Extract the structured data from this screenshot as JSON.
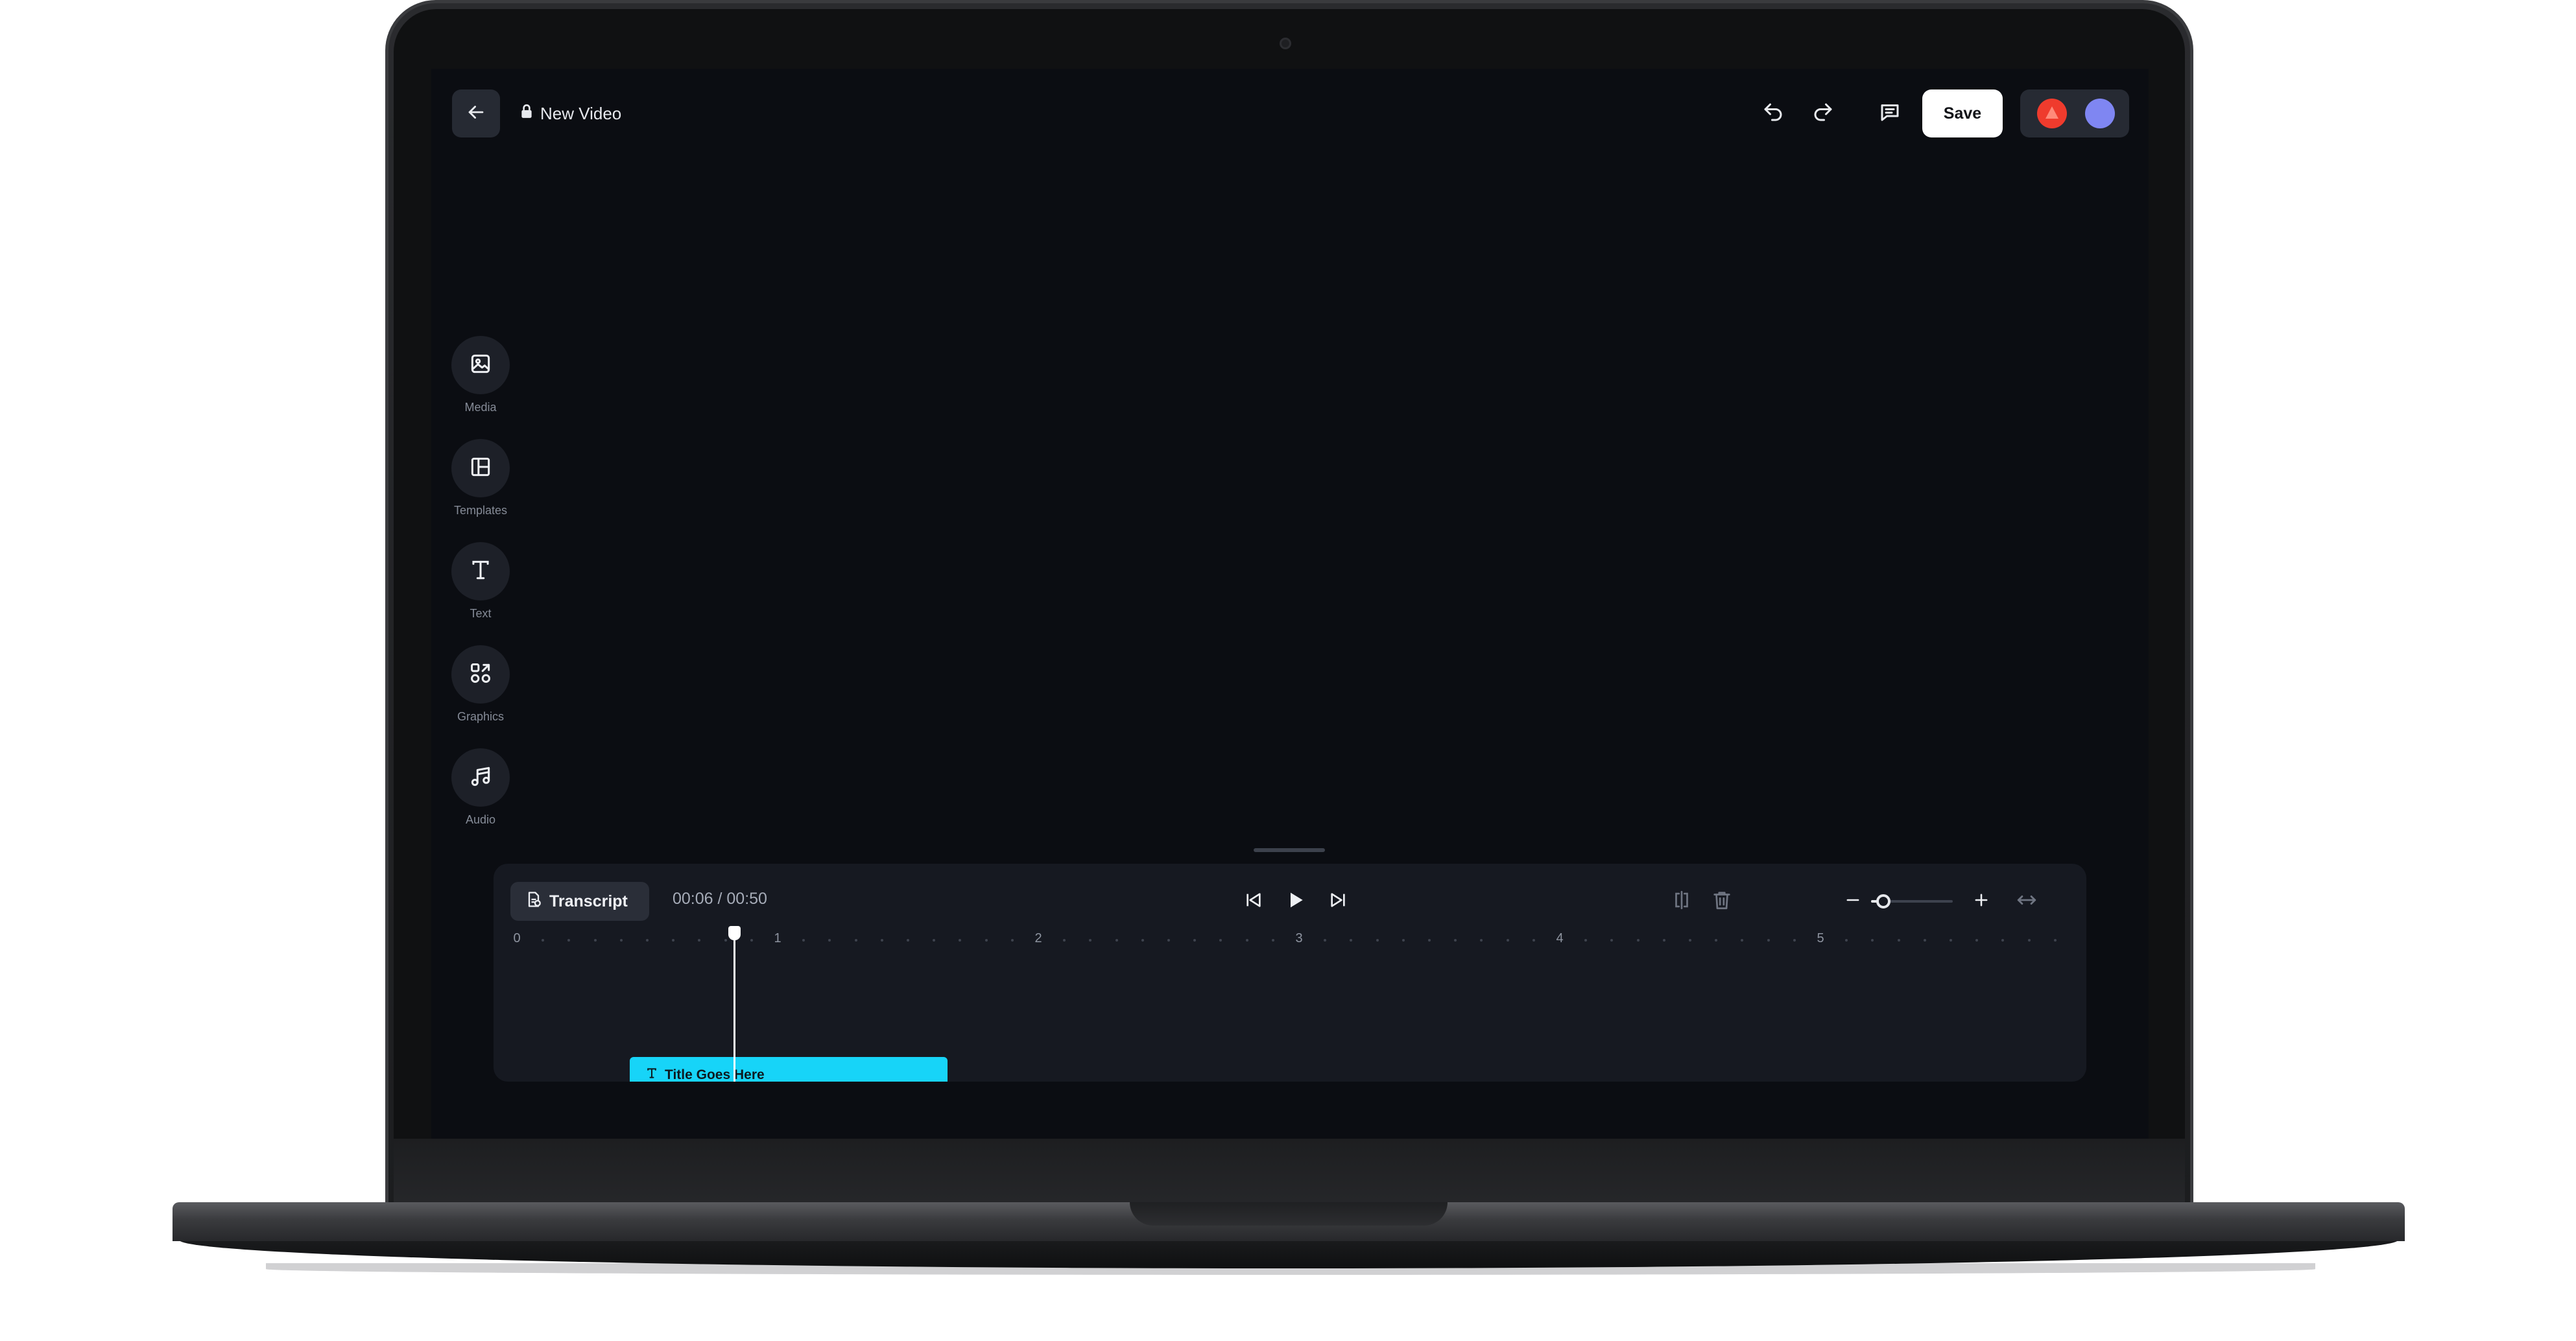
{
  "header": {
    "title": "New Video",
    "save_label": "Save",
    "collaborator_colors": [
      "#ef3b2d",
      "#7f86f2"
    ]
  },
  "sidebar": {
    "items": [
      {
        "label": "Media",
        "icon": "image-icon"
      },
      {
        "label": "Templates",
        "icon": "layout-icon"
      },
      {
        "label": "Text",
        "icon": "text-icon"
      },
      {
        "label": "Graphics",
        "icon": "shapes-icon"
      },
      {
        "label": "Audio",
        "icon": "music-icon"
      }
    ]
  },
  "timeline": {
    "transcript_label": "Transcript",
    "current_time": "00:06",
    "total_time": "00:50",
    "timecode": "00:06 / 00:50",
    "ruler_labels": [
      "0",
      "1",
      "2",
      "3",
      "4",
      "5"
    ],
    "zoom_level": 0.15,
    "title_clip_label": "Title Goes Here",
    "colors": {
      "title_clip": "#17d4f8",
      "video_track": "#9598f5"
    }
  }
}
